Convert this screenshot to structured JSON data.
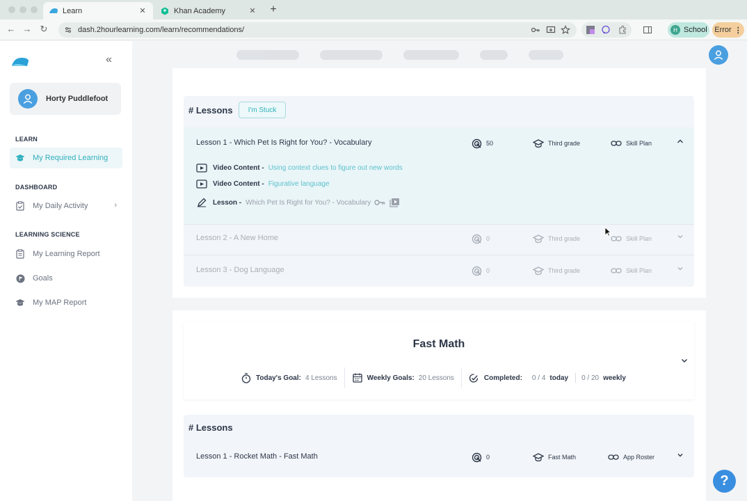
{
  "browser": {
    "tabs": [
      {
        "title": "Learn",
        "active": true
      },
      {
        "title": "Khan Academy",
        "active": false
      }
    ],
    "url": "dash.2hourlearning.com/learn/recommendations/",
    "profile_label": "School",
    "profile_initial": "H",
    "error_label": "Error"
  },
  "sidebar": {
    "user_name": "Horty Puddlefoot",
    "sections": {
      "learn": "LEARN",
      "dashboard": "DASHBOARD",
      "learning_science": "LEARNING SCIENCE"
    },
    "items": {
      "required_learning": "My Required Learning",
      "daily_activity": "My Daily Activity",
      "learning_report": "My Learning Report",
      "goals": "Goals",
      "map_report": "My MAP Report"
    }
  },
  "lessons_panel_1": {
    "heading": "# Lessons",
    "stuck_button": "I'm Stuck",
    "rows": [
      {
        "title": "Lesson 1 - Which Pet Is Right for You? - Vocabulary",
        "count": "50",
        "grade": "Third grade",
        "plan": "Skill Plan"
      },
      {
        "title": "Lesson 2 - A New Home",
        "count": "0",
        "grade": "Third grade",
        "plan": "Skill Plan"
      },
      {
        "title": "Lesson 3 - Dog Language",
        "count": "0",
        "grade": "Third grade",
        "plan": "Skill Plan"
      }
    ],
    "contents": [
      {
        "type": "Video Content -",
        "name": "Using context clues to figure out new words"
      },
      {
        "type": "Video Content -",
        "name": "Figurative language"
      },
      {
        "type": "Lesson -",
        "name": "Which Pet Is Right for You? - Vocabulary"
      }
    ]
  },
  "fast_math": {
    "title": "Fast Math",
    "todays_goal_label": "Today's Goal:",
    "todays_goal_value": "4 Lessons",
    "weekly_goal_label": "Weekly Goals:",
    "weekly_goal_value": "20 Lessons",
    "completed_label": "Completed:",
    "completed_today_value": "0 / 4",
    "completed_today_unit": "today",
    "completed_weekly_value": "0 / 20",
    "completed_weekly_unit": "weekly"
  },
  "lessons_panel_2": {
    "heading": "# Lessons",
    "rows": [
      {
        "title": "Lesson 1 - Rocket Math - Fast Math",
        "count": "0",
        "grade": "Fast Math",
        "plan": "App Roster"
      }
    ]
  },
  "help_label": "?",
  "colors": {
    "accent": "#31b1be",
    "brand_blue": "#4a9fe0",
    "help": "#3a8ee0"
  }
}
